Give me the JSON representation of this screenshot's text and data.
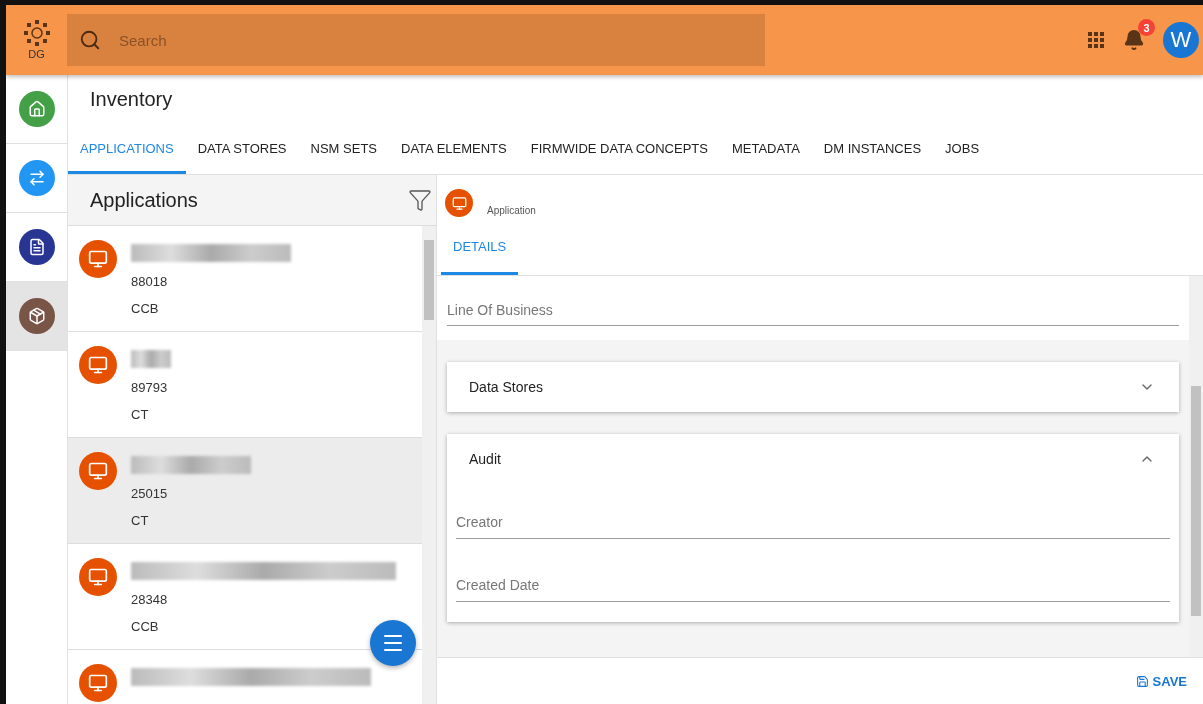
{
  "header": {
    "logo_text": "DG",
    "search": {
      "placeholder": "Search"
    },
    "notification_count": "3",
    "avatar_initial": "W"
  },
  "nav_rail": [
    {
      "kind": "home",
      "color": "#43a047",
      "selected": false
    },
    {
      "kind": "transfer",
      "color": "#2196f3",
      "selected": false
    },
    {
      "kind": "document",
      "color": "#283593",
      "selected": false
    },
    {
      "kind": "package",
      "color": "#795548",
      "selected": true
    }
  ],
  "page_title": "Inventory",
  "tabs": [
    {
      "label": "APPLICATIONS",
      "selected": true
    },
    {
      "label": "DATA STORES",
      "selected": false
    },
    {
      "label": "NSM SETS",
      "selected": false
    },
    {
      "label": "DATA ELEMENTS",
      "selected": false
    },
    {
      "label": "FIRMWIDE DATA CONCEPTS",
      "selected": false
    },
    {
      "label": "METADATA",
      "selected": false
    },
    {
      "label": "DM INSTANCES",
      "selected": false
    },
    {
      "label": "JOBS",
      "selected": false
    }
  ],
  "list_panel": {
    "title": "Applications",
    "items": [
      {
        "number": "88018",
        "group": "CCB",
        "selected": false
      },
      {
        "number": "89793",
        "group": "CT",
        "selected": false
      },
      {
        "number": "25015",
        "group": "CT",
        "selected": true
      },
      {
        "number": "28348",
        "group": "CCB",
        "selected": false
      },
      {
        "selected": false
      }
    ]
  },
  "detail": {
    "type_label": "Application",
    "tabs": [
      {
        "label": "DETAILS",
        "selected": true
      }
    ],
    "fields": [
      {
        "placeholder": "Line Of Business"
      }
    ],
    "sections": [
      {
        "title": "Data Stores",
        "expanded": false
      },
      {
        "title": "Audit",
        "expanded": true,
        "fields": [
          {
            "placeholder": "Creator"
          },
          {
            "placeholder": "Created Date"
          }
        ]
      }
    ],
    "save_label": "SAVE"
  }
}
